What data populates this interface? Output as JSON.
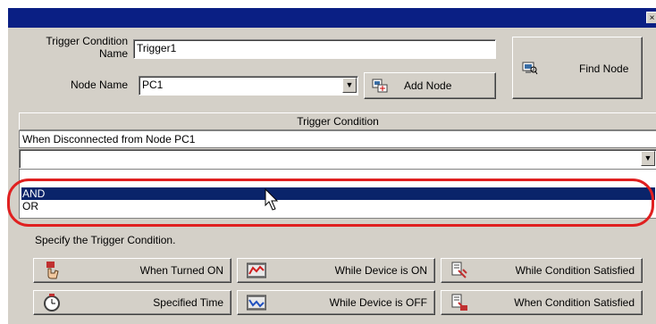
{
  "dialog": {
    "trigger_condition_name_label": "Trigger Condition\nName",
    "trigger_condition_name_value": "Trigger1",
    "node_name_label": "Node Name",
    "node_name_value": "PC1",
    "add_node_label": "Add Node",
    "find_node_label": "Find Node",
    "close_glyph": "×"
  },
  "conditions": {
    "header": "Trigger Condition",
    "row1": "When Disconnected from Node PC1",
    "list_options": [
      "AND",
      "OR"
    ],
    "selected": "AND"
  },
  "specify_label": "Specify the Trigger Condition.",
  "buttons": [
    {
      "label": "When Turned ON",
      "icon": "hand-press-icon"
    },
    {
      "label": "While Device is ON",
      "icon": "device-on-icon"
    },
    {
      "label": "While Condition Satisfied",
      "icon": "condition-satisfied-icon"
    },
    {
      "label": "Specified Time",
      "icon": "clock-icon"
    },
    {
      "label": "While Device is OFF",
      "icon": "device-off-icon"
    },
    {
      "label": "When Condition Satisfied",
      "icon": "condition-met-icon"
    }
  ],
  "colors": {
    "titlebar": "#0a1f84",
    "selection": "#0a246a",
    "highlight": "#e02020",
    "face": "#d4d0c8"
  }
}
